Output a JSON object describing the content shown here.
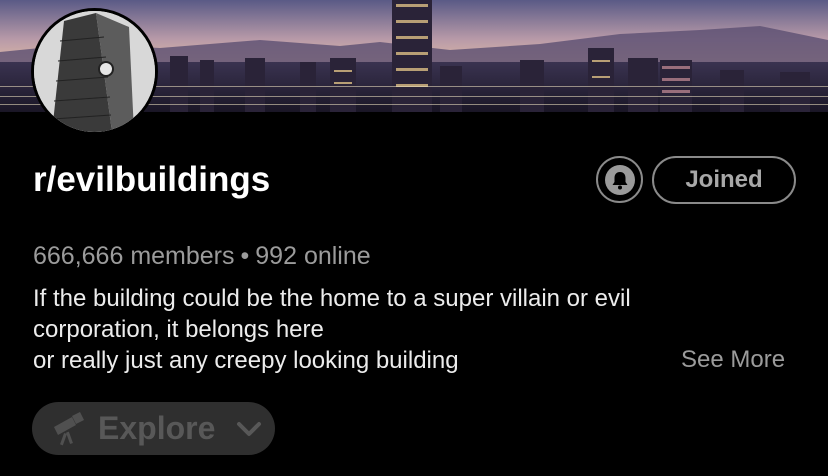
{
  "subreddit": {
    "name": "r/evilbuildings",
    "members": "666,666 members",
    "separator": "•",
    "online": "992 online"
  },
  "actions": {
    "notification_icon": "bell-icon",
    "joined_label": "Joined"
  },
  "description": {
    "lines": [
      "If the building could be the home to a super villain or evil",
      "corporation, it belongs here",
      "or really just any creepy looking building"
    ],
    "see_more": "See More"
  },
  "explore": {
    "icon": "telescope-icon",
    "label": "Explore",
    "chevron_icon": "chevron-down-icon"
  },
  "colors": {
    "background": "#000000",
    "secondary_text": "#9b9b9b",
    "button_border": "#8a8a8a",
    "explore_bg": "#2f2f2f"
  }
}
